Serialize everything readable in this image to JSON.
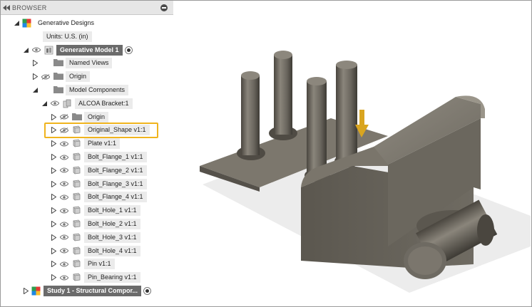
{
  "browser": {
    "title": "BROWSER",
    "collapse_icon": "double-left-arrow-icon",
    "options_icon": "minus-circle-icon"
  },
  "tree": [
    {
      "id": "generative-designs",
      "label": "Generative Designs",
      "indent": 0,
      "expand": "down",
      "eye": false,
      "icon": "generative-designs-icon",
      "style": "plain"
    },
    {
      "id": "units",
      "label": "Units: U.S. (in)",
      "indent": 1,
      "expand": "none",
      "eye": false,
      "icon": "document-icon",
      "style": "light"
    },
    {
      "id": "generative-model-1",
      "label": "Generative Model 1",
      "indent": 1,
      "expand": "down",
      "eye": true,
      "icon": "model-icon",
      "style": "dark",
      "radio": true
    },
    {
      "id": "named-views",
      "label": "Named Views",
      "indent": 2,
      "expand": "right",
      "eye": false,
      "icon": "folder-icon",
      "style": "light"
    },
    {
      "id": "origin",
      "label": "Origin",
      "indent": 2,
      "expand": "right",
      "eye": "hidden",
      "icon": "folder-icon",
      "style": "light"
    },
    {
      "id": "model-components",
      "label": "Model Components",
      "indent": 2,
      "expand": "down",
      "eye": false,
      "icon": "folder-icon",
      "style": "light"
    },
    {
      "id": "alcoa-bracket",
      "label": "ALCOA Bracket:1",
      "indent": 3,
      "expand": "down",
      "eye": true,
      "icon": "component-icon",
      "style": "light"
    },
    {
      "id": "origin-2",
      "label": "Origin",
      "indent": 4,
      "expand": "right",
      "eye": "hidden",
      "icon": "folder-icon",
      "style": "light"
    },
    {
      "id": "original-shape",
      "label": "Original_Shape v1:1",
      "indent": 4,
      "expand": "right",
      "eye": "hidden",
      "icon": "body-icon",
      "style": "light",
      "highlight": true
    },
    {
      "id": "plate",
      "label": "Plate v1:1",
      "indent": 4,
      "expand": "right",
      "eye": true,
      "icon": "body-icon",
      "style": "light"
    },
    {
      "id": "bolt-flange-1",
      "label": "Bolt_Flange_1 v1:1",
      "indent": 4,
      "expand": "right",
      "eye": true,
      "icon": "body-icon",
      "style": "light"
    },
    {
      "id": "bolt-flange-2",
      "label": "Bolt_Flange_2 v1:1",
      "indent": 4,
      "expand": "right",
      "eye": true,
      "icon": "body-icon",
      "style": "light"
    },
    {
      "id": "bolt-flange-3",
      "label": "Bolt_Flange_3 v1:1",
      "indent": 4,
      "expand": "right",
      "eye": true,
      "icon": "body-icon",
      "style": "light"
    },
    {
      "id": "bolt-flange-4",
      "label": "Bolt_Flange_4 v1:1",
      "indent": 4,
      "expand": "right",
      "eye": true,
      "icon": "body-icon",
      "style": "light"
    },
    {
      "id": "bolt-hole-1",
      "label": "Bolt_Hole_1 v1:1",
      "indent": 4,
      "expand": "right",
      "eye": true,
      "icon": "body-icon",
      "style": "light"
    },
    {
      "id": "bolt-hole-2",
      "label": "Bolt_Hole_2 v1:1",
      "indent": 4,
      "expand": "right",
      "eye": true,
      "icon": "body-icon",
      "style": "light"
    },
    {
      "id": "bolt-hole-3",
      "label": "Bolt_Hole_3 v1:1",
      "indent": 4,
      "expand": "right",
      "eye": true,
      "icon": "body-icon",
      "style": "light"
    },
    {
      "id": "bolt-hole-4",
      "label": "Bolt_Hole_4 v1:1",
      "indent": 4,
      "expand": "right",
      "eye": true,
      "icon": "body-icon",
      "style": "light"
    },
    {
      "id": "pin",
      "label": "Pin v1:1",
      "indent": 4,
      "expand": "right",
      "eye": true,
      "icon": "body-icon",
      "style": "light"
    },
    {
      "id": "pin-bearing",
      "label": "Pin_Bearing v1:1",
      "indent": 4,
      "expand": "right",
      "eye": true,
      "icon": "body-icon",
      "style": "light"
    },
    {
      "id": "study-1",
      "label": "Study 1 - Structural Compor...",
      "indent": 1,
      "expand": "right",
      "eye": false,
      "icon": "study-icon",
      "style": "dark",
      "radio": true
    }
  ],
  "colors": {
    "highlight": "#f0b41e",
    "row_bg": "#ebebeb",
    "dark_row_bg": "#6b6b6b",
    "model_body": "#6e6a62",
    "load_arrow": "#d9a520"
  }
}
